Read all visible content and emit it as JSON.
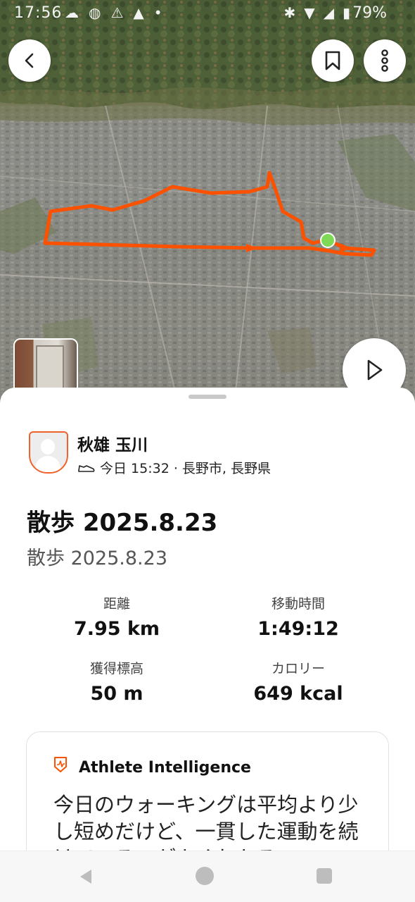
{
  "status_bar": {
    "time": "17:56",
    "battery": "79%",
    "left_icons": [
      "chat-icon",
      "headset-icon",
      "warning-icon",
      "mountain-icon",
      "dot-icon"
    ],
    "right_icons": [
      "bluetooth-icon",
      "wifi-icon",
      "signal-icon",
      "battery-icon"
    ]
  },
  "map": {
    "route_color": "#fc5200",
    "start_marker_color": "#7ed957",
    "buttons": [
      "back-icon",
      "bookmark-icon",
      "more-icon",
      "play-icon"
    ]
  },
  "athlete": {
    "name": "秋雄 玉川",
    "meta": "今日 15:32 · 長野市, 長野県"
  },
  "activity": {
    "title": "散歩 2025.8.23",
    "subtitle": "散歩 2025.8.23"
  },
  "stats": [
    {
      "label": "距離",
      "value": "7.95 km"
    },
    {
      "label": "移動時間",
      "value": "1:49:12"
    },
    {
      "label": "獲得標高",
      "value": "50 m"
    },
    {
      "label": "カロリー",
      "value": "649 kcal"
    }
  ],
  "athlete_intelligence": {
    "title": "Athlete Intelligence",
    "text": "今日のウォーキングは平均より少し短めだけど、一貫した運動を続けているのがよくわかる"
  },
  "colors": {
    "brand_orange": "#fc5200",
    "text_primary": "#111111",
    "text_secondary": "#555555"
  }
}
